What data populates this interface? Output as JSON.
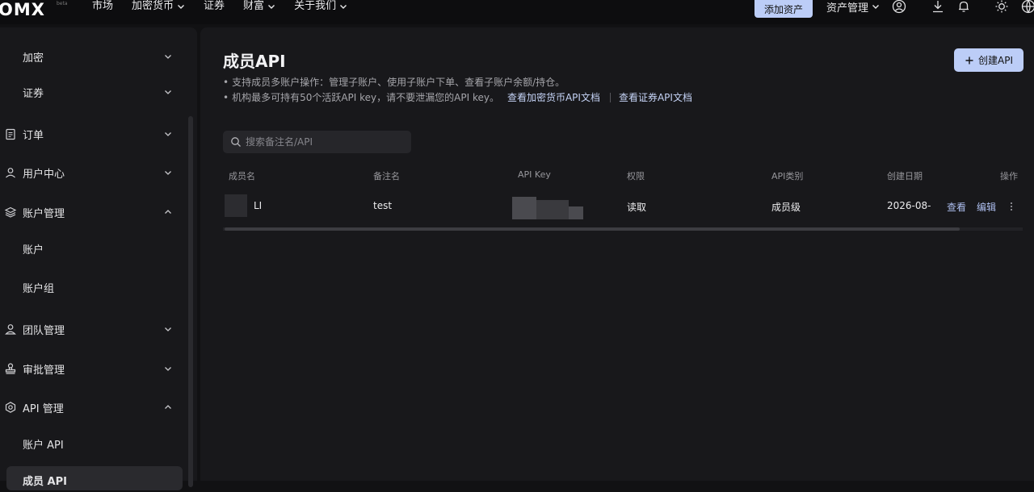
{
  "header": {
    "logo": "OMX",
    "logo_tag": "beta",
    "nav": [
      {
        "label": "市场",
        "has_dropdown": false
      },
      {
        "label": "加密货币",
        "has_dropdown": true
      },
      {
        "label": "证券",
        "has_dropdown": false
      },
      {
        "label": "财富",
        "has_dropdown": true
      },
      {
        "label": "关于我们",
        "has_dropdown": true
      }
    ],
    "add_asset_label": "添加资产",
    "asset_mgmt_label": "资产管理"
  },
  "sidebar": {
    "items": [
      {
        "label": "加密",
        "icon": "none",
        "arrow": "down"
      },
      {
        "label": "证券",
        "icon": "none",
        "arrow": "down"
      },
      {
        "label": "订单",
        "icon": "clipboard-icon",
        "arrow": "down"
      },
      {
        "label": "用户中心",
        "icon": "user-icon",
        "arrow": "down"
      },
      {
        "label": "账户管理",
        "icon": "layers-icon",
        "arrow": "up"
      },
      {
        "label": "账户",
        "icon": "none",
        "arrow": "none"
      },
      {
        "label": "账户组",
        "icon": "none",
        "arrow": "none"
      },
      {
        "label": "团队管理",
        "icon": "team-icon",
        "arrow": "down"
      },
      {
        "label": "审批管理",
        "icon": "stamp-icon",
        "arrow": "down"
      },
      {
        "label": "API 管理",
        "icon": "hexagon-icon",
        "arrow": "up"
      },
      {
        "label": "账户 API",
        "icon": "none",
        "arrow": "none"
      },
      {
        "label": "成员 API",
        "icon": "none",
        "arrow": "none"
      }
    ]
  },
  "main": {
    "title": "成员API",
    "create_button": "创建API",
    "desc_line1": "支持成员多账户操作：管理子账户、使用子账户下单、查看子账户余额/持仓。",
    "desc_line2": "机构最多可持有50个活跃API key，请不要泄漏您的API key。",
    "link_crypto_docs": "查看加密货币API文档",
    "link_securities_docs": "查看证券API文档",
    "search_placeholder": "搜索备注名/API",
    "columns": [
      "成员名",
      "备注名",
      "API Key",
      "权限",
      "API类别",
      "创建日期",
      "操作"
    ],
    "row": {
      "member": "LI",
      "remark": "test",
      "permission": "读取",
      "api_type": "成员级",
      "created": "2026-08-",
      "view": "查看",
      "edit": "编辑"
    }
  },
  "colors": {
    "accent": "#bccdf7",
    "link": "#c5d3f6",
    "background": "#111113",
    "panel": "#18181b"
  }
}
